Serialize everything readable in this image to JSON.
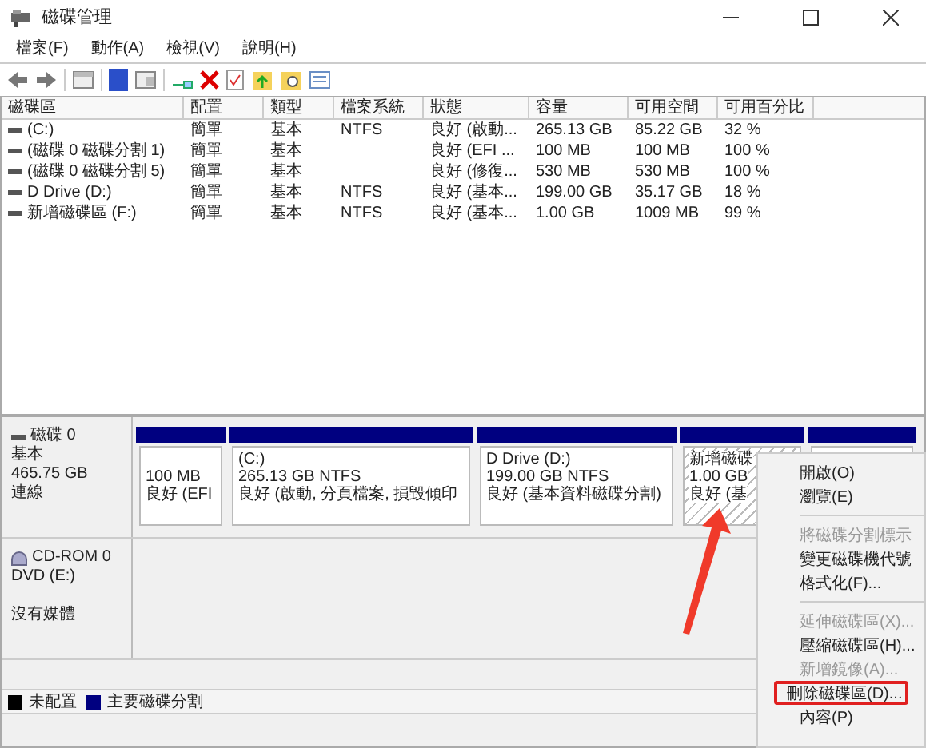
{
  "window": {
    "title": "磁碟管理"
  },
  "menu_bar": [
    "檔案(F)",
    "動作(A)",
    "檢視(V)",
    "說明(H)"
  ],
  "volume_table": {
    "columns": [
      "磁碟區",
      "配置",
      "類型",
      "檔案系統",
      "狀態",
      "容量",
      "可用空間",
      "可用百分比"
    ],
    "rows": [
      [
        "(C:)",
        "簡單",
        "基本",
        "NTFS",
        "良好 (啟動...",
        "265.13 GB",
        "85.22 GB",
        "32 %"
      ],
      [
        "(磁碟 0 磁碟分割 1)",
        "簡單",
        "基本",
        "",
        "良好 (EFI ...",
        "100 MB",
        "100 MB",
        "100 %"
      ],
      [
        "(磁碟 0 磁碟分割 5)",
        "簡單",
        "基本",
        "",
        "良好 (修復...",
        "530 MB",
        "530 MB",
        "100 %"
      ],
      [
        "D Drive (D:)",
        "簡單",
        "基本",
        "NTFS",
        "良好 (基本...",
        "199.00 GB",
        "35.17 GB",
        "18 %"
      ],
      [
        "新增磁碟區 (F:)",
        "簡單",
        "基本",
        "NTFS",
        "良好 (基本...",
        "1.00 GB",
        "1009 MB",
        "99 %"
      ]
    ]
  },
  "disks": [
    {
      "kind": "disk",
      "name": "磁碟 0",
      "type": "基本",
      "size": "465.75 GB",
      "state": "連線",
      "partitions": [
        {
          "selected": false,
          "capacity": "100 MB",
          "status": "良好 (EFI"
        },
        {
          "selected": false,
          "label": "(C:)",
          "capacity": "265.13 GB NTFS",
          "status": "良好 (啟動, 分頁檔案, 損毀傾印"
        },
        {
          "selected": false,
          "label": "D Drive  (D:)",
          "capacity": "199.00 GB NTFS",
          "status": "良好 (基本資料磁碟分割)"
        },
        {
          "selected": true,
          "label": "新增磁碟",
          "capacity": "1.00 GB",
          "status": "良好 (基"
        },
        {
          "selected": false
        }
      ]
    },
    {
      "kind": "cdrom",
      "name": "CD-ROM 0",
      "drive": "DVD (E:)",
      "media": "沒有媒體"
    }
  ],
  "legend": [
    {
      "label": "未配置",
      "color": "#000000"
    },
    {
      "label": "主要磁碟分割",
      "color": "#000080"
    }
  ],
  "context_menu": [
    {
      "kind": "item",
      "label": "開啟(O)",
      "disabled": false,
      "highlighted": false
    },
    {
      "kind": "item",
      "label": "瀏覽(E)",
      "disabled": false,
      "highlighted": false
    },
    {
      "kind": "separator"
    },
    {
      "kind": "item",
      "label": "將磁碟分割標示",
      "disabled": true,
      "highlighted": false
    },
    {
      "kind": "item",
      "label": "變更磁碟機代號",
      "disabled": false,
      "highlighted": false
    },
    {
      "kind": "item",
      "label": "格式化(F)...",
      "disabled": false,
      "highlighted": false
    },
    {
      "kind": "separator"
    },
    {
      "kind": "item",
      "label": "延伸磁碟區(X)...",
      "disabled": true,
      "highlighted": false
    },
    {
      "kind": "item",
      "label": "壓縮磁碟區(H)...",
      "disabled": false,
      "highlighted": false
    },
    {
      "kind": "item",
      "label": "新增鏡像(A)...",
      "disabled": true,
      "highlighted": false
    },
    {
      "kind": "item",
      "label": "刪除磁碟區(D)...",
      "disabled": false,
      "highlighted": true
    },
    {
      "kind": "item",
      "label": "內容(P)",
      "disabled": false,
      "highlighted": false
    }
  ]
}
